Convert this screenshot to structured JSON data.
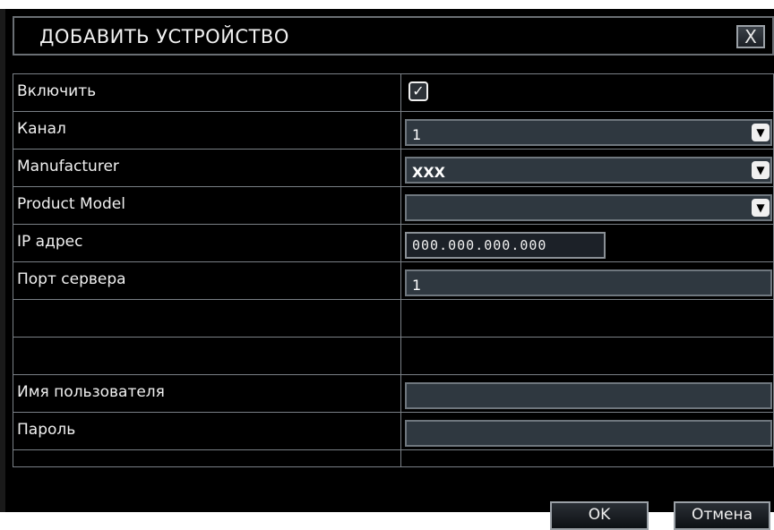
{
  "dialog": {
    "title": "ДОБАВИТЬ УСТРОЙСТВО",
    "close_label": "X"
  },
  "form": {
    "enable_label": "Включить",
    "enable_checked": true,
    "channel_label": "Канал",
    "channel_value": "1",
    "manufacturer_label": "Manufacturer",
    "manufacturer_value": "XXX",
    "product_model_label": "Product Model",
    "product_model_value": "",
    "ip_label": "IP адрес",
    "ip_value": "000.000.000.000",
    "port_label": "Порт сервера",
    "port_value": "1",
    "username_label": "Имя пользователя",
    "username_value": "",
    "password_label": "Пароль",
    "password_value": ""
  },
  "buttons": {
    "ok_label": "OK",
    "cancel_label": "Отмена"
  },
  "icons": {
    "checkbox": "check-icon",
    "dropdown": "chevron-down-icon",
    "close": "close-icon"
  },
  "colors": {
    "background": "#000000",
    "field": "#2f3840",
    "border": "#7a8086",
    "text": "#f0f0f0"
  }
}
